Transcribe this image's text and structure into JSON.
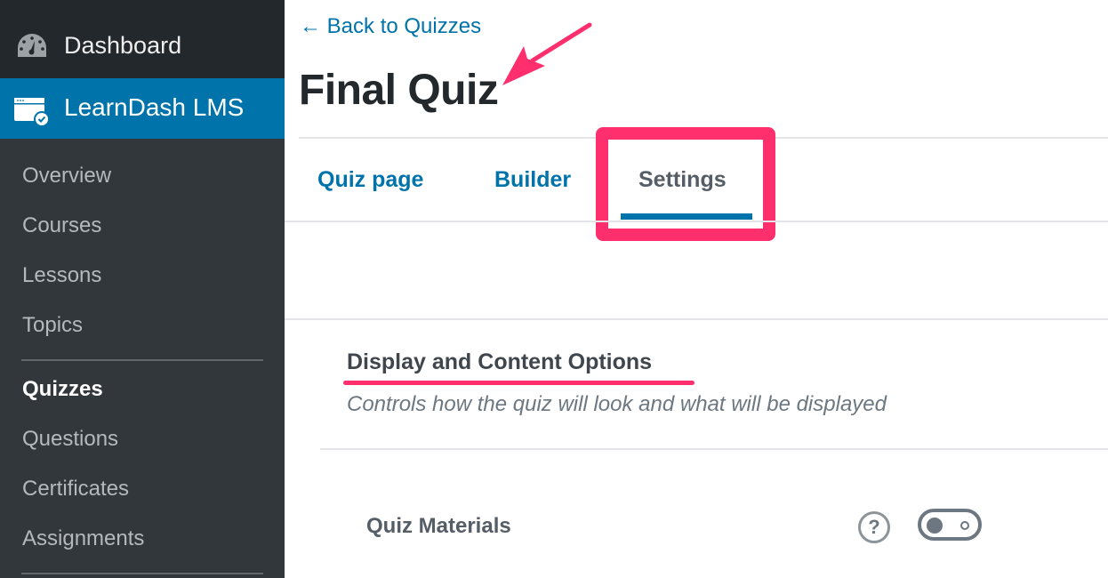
{
  "sidebar": {
    "dashboard_label": "Dashboard",
    "dashboard_icon": "dashboard-gauge-icon",
    "active_menu_label": "LearnDash LMS",
    "active_menu_icon": "learndash-browser-check-icon",
    "submenu": [
      {
        "label": "Overview",
        "current": false
      },
      {
        "label": "Courses",
        "current": false
      },
      {
        "label": "Lessons",
        "current": false
      },
      {
        "label": "Topics",
        "current": false
      },
      {
        "label": "Quizzes",
        "current": true
      },
      {
        "label": "Questions",
        "current": false
      },
      {
        "label": "Certificates",
        "current": false
      },
      {
        "label": "Assignments",
        "current": false
      }
    ]
  },
  "header": {
    "back_link": "← Back to Quizzes",
    "title": "Final Quiz"
  },
  "tabs": [
    {
      "label": "Quiz page",
      "active": false
    },
    {
      "label": "Builder",
      "active": false
    },
    {
      "label": "Settings",
      "active": true
    }
  ],
  "section": {
    "title": "Display and Content Options",
    "description": "Controls how the quiz will look and what will be displayed"
  },
  "settings": [
    {
      "label": "Quiz Materials",
      "help_icon": "?",
      "enabled": false
    }
  ],
  "colors": {
    "accent": "#0073aa",
    "annotation": "#ff2f6e",
    "sidebar_bg": "#32373c",
    "sidebar_top_bg": "#23282d"
  }
}
